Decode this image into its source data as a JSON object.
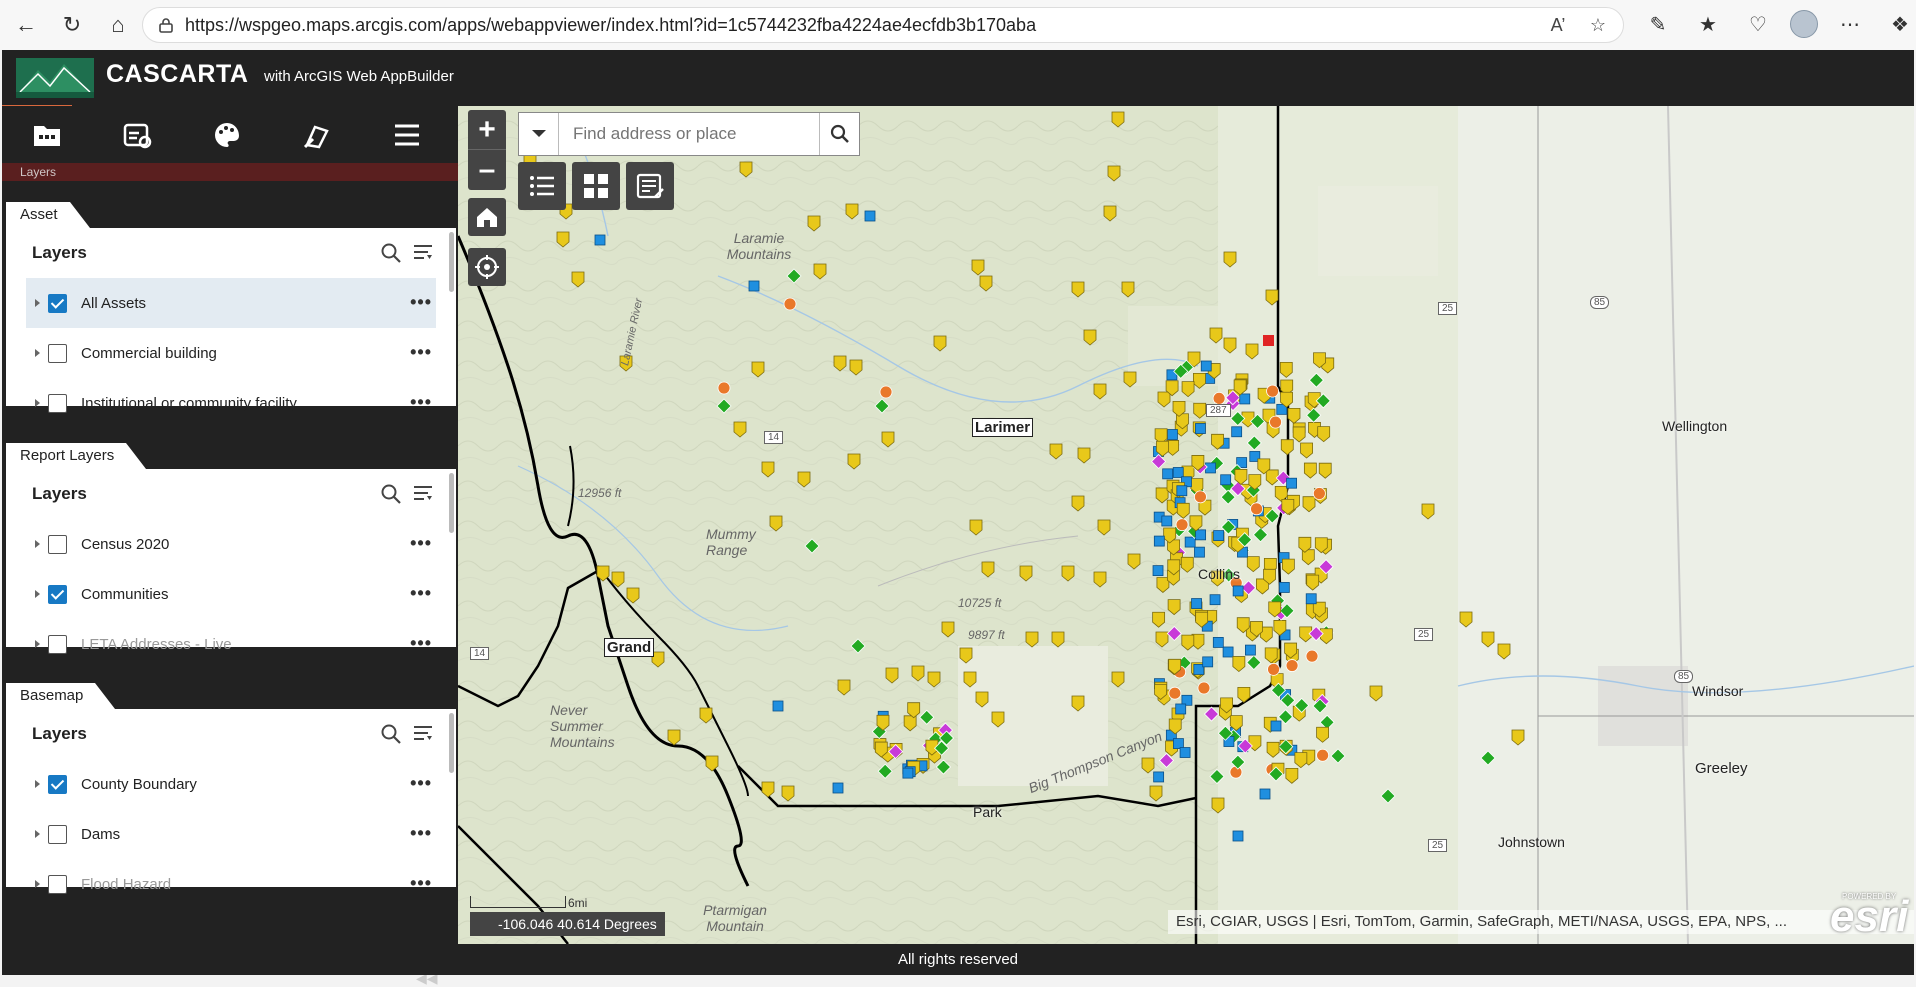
{
  "browser": {
    "url": "https://wspgeo.maps.arcgis.com/apps/webappviewer/index.html?id=1c5744232fba4224ae4ecfdb3b170aba"
  },
  "app": {
    "title": "CASCARTA",
    "subtitle": "with ArcGIS Web AppBuilder",
    "panel_title": "Layers",
    "footer": "All rights reserved"
  },
  "sidebar_tabs": [
    "layers-tab",
    "legend-tab",
    "basemap-tab",
    "draw-tab",
    "more-tab"
  ],
  "groups": [
    {
      "tab": "Asset",
      "title": "Layers",
      "layers": [
        {
          "name": "All Assets",
          "checked": true,
          "selected": true,
          "dim": false
        },
        {
          "name": "Commercial building",
          "checked": false,
          "selected": false,
          "dim": false
        },
        {
          "name": "Institutional or community facility",
          "checked": false,
          "selected": false,
          "dim": false
        }
      ]
    },
    {
      "tab": "Report Layers",
      "title": "Layers",
      "layers": [
        {
          "name": "Census 2020",
          "checked": false,
          "selected": false,
          "dim": false
        },
        {
          "name": "Communities",
          "checked": true,
          "selected": false,
          "dim": false
        },
        {
          "name": "LETA Addresses - Live",
          "checked": false,
          "selected": false,
          "dim": true
        }
      ]
    },
    {
      "tab": "Basemap",
      "title": "Layers",
      "layers": [
        {
          "name": "County Boundary",
          "checked": true,
          "selected": false,
          "dim": false
        },
        {
          "name": "Dams",
          "checked": false,
          "selected": false,
          "dim": false
        },
        {
          "name": "Flood Hazard",
          "checked": false,
          "selected": false,
          "dim": true
        }
      ]
    }
  ],
  "map": {
    "search_placeholder": "Find address or place",
    "coordinates": "-106.046 40.614 Degrees",
    "scale_label": "6mi",
    "attribution": "Esri, CGIAR, USGS | Esri, TomTom, Garmin, SafeGraph, METI/NASA, USGS, EPA, NPS, ...",
    "esri_logo": "esri",
    "esri_powered": "POWERED BY",
    "labels": {
      "larimer": "Larimer",
      "grand": "Grand",
      "laramie_mtns": "Laramie Mountains",
      "mummy_range": "Mummy Range",
      "never_summer": "Never Summer Mountains",
      "ptarmigan": "Ptarmigan Mountain",
      "big_thompson": "Big Thompson Canyon",
      "laramie_river": "Laramie River",
      "elev_12956": "12956 ft",
      "elev_10725": "10725 ft",
      "elev_9897": "9897 ft",
      "wellington": "Wellington",
      "windsor": "Windsor",
      "greeley": "Greeley",
      "johnstown": "Johnstown",
      "fort_collins": "Collins",
      "estes_park": "Park",
      "hwy_14a": "14",
      "hwy_14b": "14",
      "hwy_287": "287",
      "hwy_85a": "85",
      "hwy_85b": "85",
      "hwy_25a": "25",
      "hwy_25b": "25",
      "hwy_25c": "25"
    }
  },
  "colors": {
    "yellow_marker": "#e8c81a",
    "blue_marker": "#1f8fe0",
    "green_marker": "#22aa22",
    "orange_marker": "#e9782a",
    "purple_marker": "#c83ad8",
    "red_marker": "#e02424",
    "accent": "#1779c4"
  }
}
